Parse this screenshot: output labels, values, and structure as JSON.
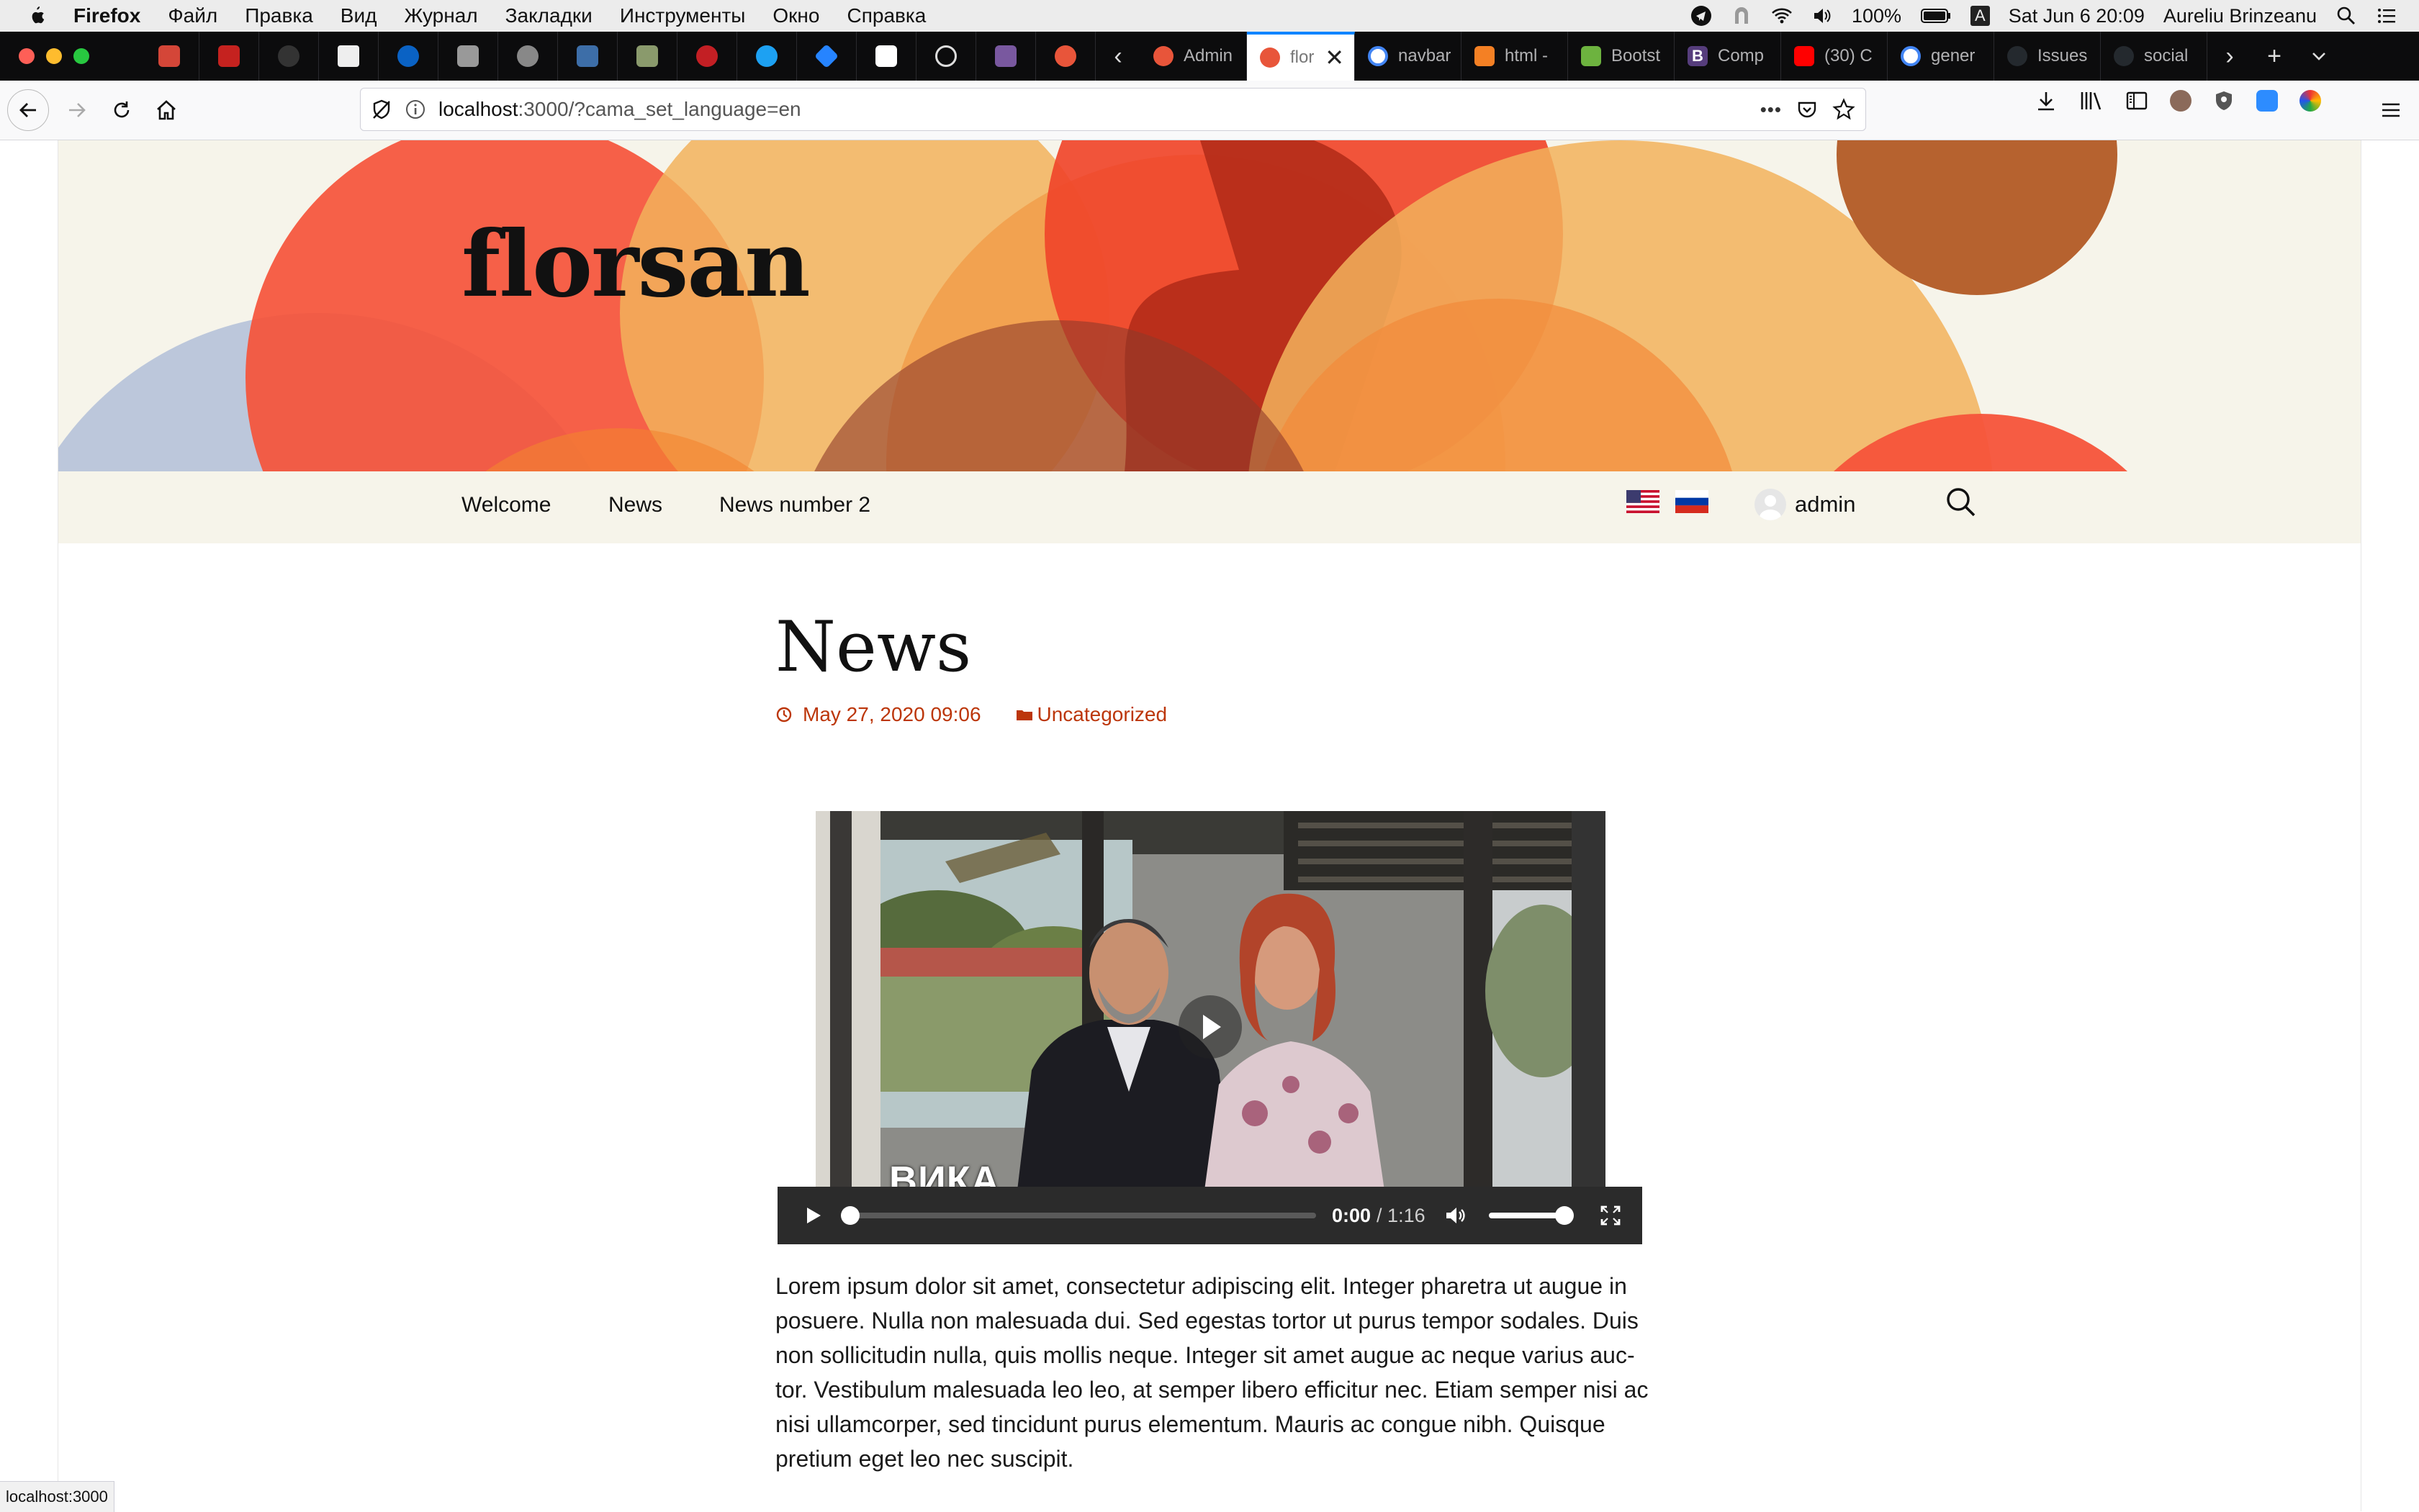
{
  "menubar": {
    "app": "Firefox",
    "items": [
      "Файл",
      "Правка",
      "Вид",
      "Журнал",
      "Закладки",
      "Инструменты",
      "Окно",
      "Справка"
    ],
    "battery": "100%",
    "keyboard_indicator": "A",
    "datetime": "Sat Jun 6  20:09",
    "user": "Aureliu Brinzeanu"
  },
  "tabs": {
    "pinned_icons": [
      "gmail-icon",
      "gmail-icon",
      "github-icon",
      "arrow-icon",
      "onepassword-icon",
      "puzzle-icon",
      "timer-icon",
      "notes-icon",
      "star-icon",
      "redux-icon",
      "twitter-icon",
      "jira-icon",
      "notion-icon",
      "globe-icon",
      "heroku-icon",
      "peach-icon"
    ],
    "items": [
      {
        "label": "Admin",
        "icon": "peach-icon",
        "color": "#e8553a"
      },
      {
        "label": "flor",
        "icon": "peach-icon",
        "color": "#e8553a",
        "active": true
      },
      {
        "label": "navbar",
        "icon": "google-icon",
        "color": "#4285f4"
      },
      {
        "label": "html -",
        "icon": "stackoverflow-icon",
        "color": "#f48024"
      },
      {
        "label": "Bootst",
        "icon": "bootstrap-icon",
        "color": "#6db33f"
      },
      {
        "label": "Comp",
        "icon": "bootstrap-b-icon",
        "color": "#563d7c"
      },
      {
        "label": "(30) C",
        "icon": "youtube-icon",
        "color": "#ff0000"
      },
      {
        "label": "gener",
        "icon": "google-icon",
        "color": "#4285f4"
      },
      {
        "label": "Issues",
        "icon": "github-icon",
        "color": "#24292e"
      },
      {
        "label": "social",
        "icon": "github-icon",
        "color": "#24292e"
      }
    ]
  },
  "toolbar": {
    "url_host": "localhost",
    "url_rest": ":3000/?cama_set_language=en",
    "more": "•••"
  },
  "site": {
    "title": "florsan",
    "nav": [
      "Welcome",
      "News",
      "News number 2"
    ],
    "user": "admin"
  },
  "post": {
    "title": "News",
    "date": "May 27, 2020 09:06",
    "category": "Uncategorized",
    "video": {
      "time_current": "0:00",
      "time_total": "/ 1:16",
      "overlay_text": "ВИКА",
      "progress": 0,
      "volume": 0.9
    },
    "body": "Lorem ipsum dolor sit amet, consectetur adipiscing elit. Integer pharetra ut augue in posuere. Nulla non malesuada dui. Sed egestas tortor ut purus tempor sodales. Duis non sollicitudin nulla, quis mollis neque. Integer sit amet augue ac neque varius auc­tor. Vestibulum malesuada leo leo, at semper libero efficitur nec. Etiam semper nisi ac nisi ullamcorper, sed tincidunt purus elementum. Mauris ac congue nibh. Quisque pretium eget leo nec suscipit."
  },
  "statusbar": "localhost:3000",
  "colors": {
    "accent": "#bc360a",
    "header_bg": "#f6f4ea",
    "firefox_blue": "#0a84ff"
  }
}
